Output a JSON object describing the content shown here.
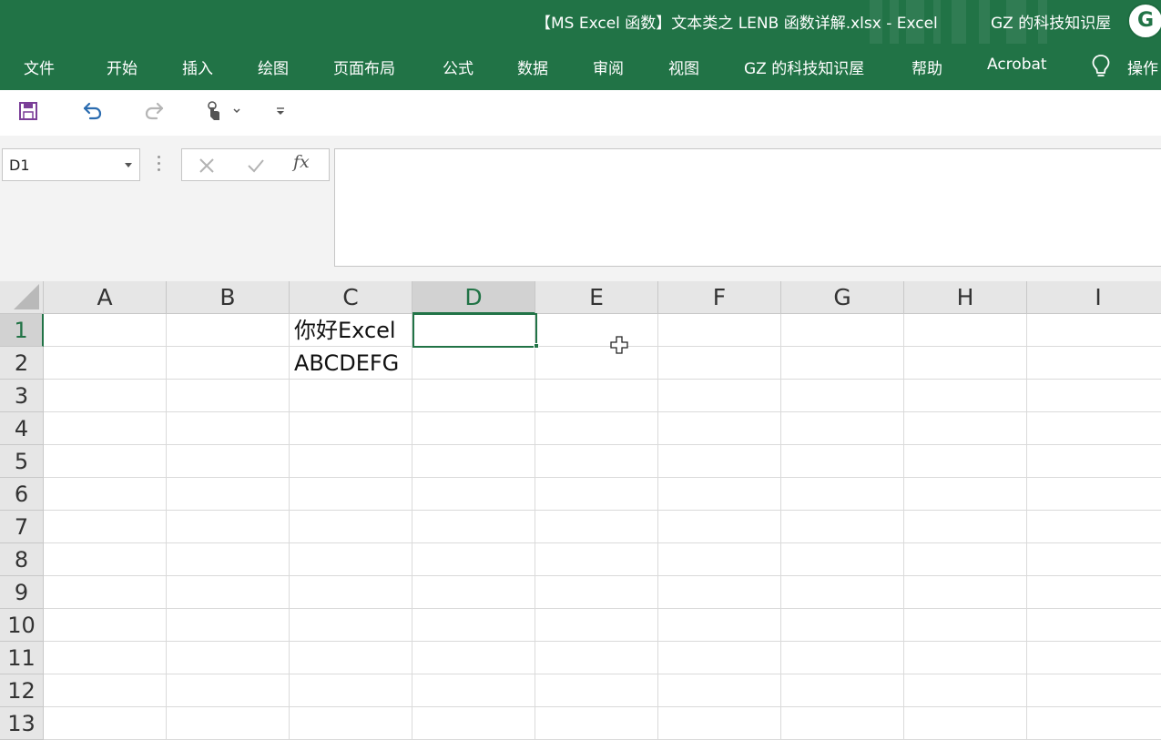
{
  "window": {
    "title": "【MS Excel 函数】文本类之 LENB 函数详解.xlsx  -  Excel",
    "account": "GZ 的科技知识屋",
    "avatar_letter": "G"
  },
  "ribbon": {
    "tabs": [
      "文件",
      "开始",
      "插入",
      "绘图",
      "页面布局",
      "公式",
      "数据",
      "审阅",
      "视图",
      "GZ 的科技知识屋",
      "帮助",
      "Acrobat"
    ],
    "tell_me": "操作"
  },
  "quick_access": {
    "icons": [
      "save-icon",
      "undo-icon",
      "redo-icon",
      "touch-mode-icon",
      "customize-qat-icon"
    ]
  },
  "formula_bar": {
    "name_box": "D1",
    "fx_label": "fx",
    "formula": ""
  },
  "sheet": {
    "columns": [
      "A",
      "B",
      "C",
      "D",
      "E",
      "F",
      "G",
      "H",
      "I"
    ],
    "rows": [
      "1",
      "2",
      "3",
      "4",
      "5",
      "6",
      "7",
      "8",
      "9",
      "10",
      "11",
      "12",
      "13"
    ],
    "selected_column": "D",
    "selected_row": "1",
    "cells": {
      "C1": "你好Excel",
      "C2": "ABCDEFG"
    }
  },
  "colors": {
    "accent": "#217346",
    "header_bg": "#e6e6e6",
    "gridline": "#dadada"
  }
}
